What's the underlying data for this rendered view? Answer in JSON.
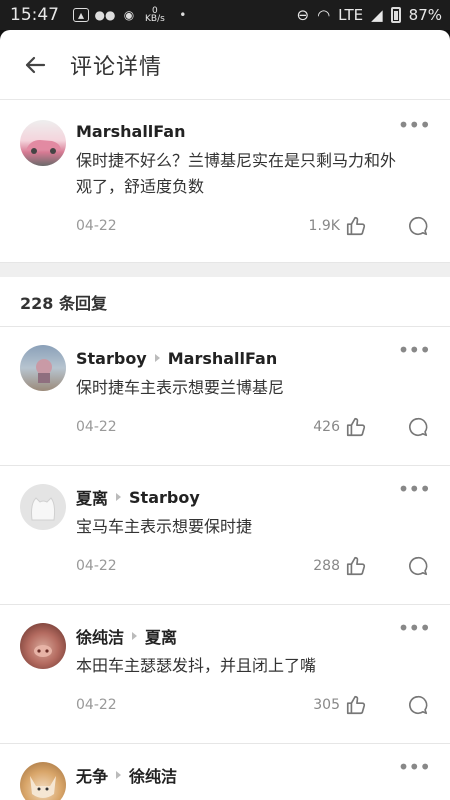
{
  "status": {
    "time": "15:47",
    "speed_num": "0",
    "speed_unit": "KB/s",
    "network": "LTE",
    "battery": "87%"
  },
  "header": {
    "title": "评论详情"
  },
  "main_comment": {
    "user": "MarshallFan",
    "text": "保时捷不好么？兰博基尼实在是只剩马力和外观了，舒适度负数",
    "date": "04-22",
    "likes": "1.9K"
  },
  "reply_count": "228 条回复",
  "replies": [
    {
      "user": "Starboy",
      "reply_to": "MarshallFan",
      "text": "保时捷车主表示想要兰博基尼",
      "date": "04-22",
      "likes": "426"
    },
    {
      "user": "夏离",
      "reply_to": "Starboy",
      "text": "宝马车主表示想要保时捷",
      "date": "04-22",
      "likes": "288"
    },
    {
      "user": "徐纯洁",
      "reply_to": "夏离",
      "text": "本田车主瑟瑟发抖，并且闭上了嘴",
      "date": "04-22",
      "likes": "305"
    },
    {
      "user": "无争",
      "reply_to": "徐纯洁",
      "text": "",
      "date": "",
      "likes": ""
    }
  ],
  "more_glyph": "•••"
}
